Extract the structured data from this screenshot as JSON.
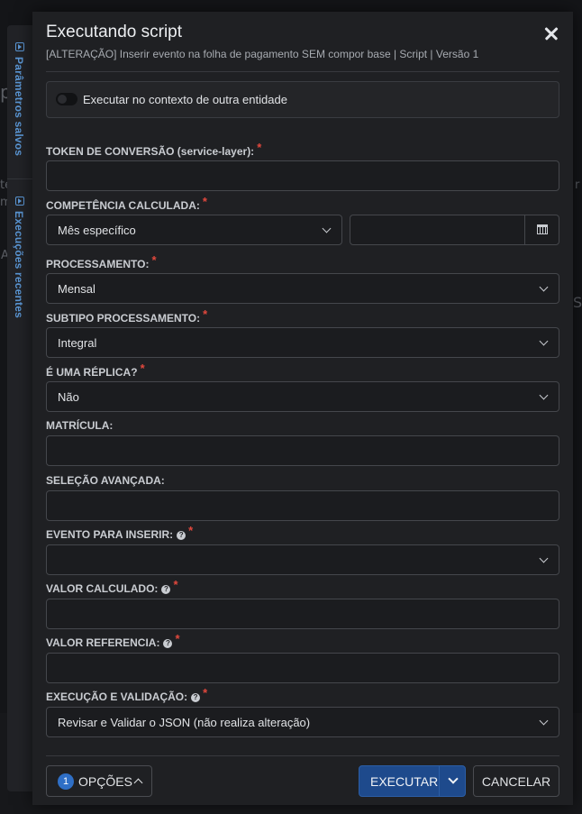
{
  "background": {
    "fragments": [
      "p",
      "te",
      "m",
      "A",
      "r",
      "S"
    ]
  },
  "side_panel": {
    "tab_saved": "Parâmetros salvos",
    "tab_recent": "Execuções recentes"
  },
  "modal": {
    "title": "Executando script",
    "subtitle": "[ALTERAÇÃO] Inserir evento na folha de pagamento SEM compor base | Script | Versão 1",
    "context_toggle": {
      "label": "Executar no contexto de outra entidade",
      "enabled": false
    },
    "required_mark": "*",
    "help_mark": "?",
    "fields": {
      "token": {
        "label": "TOKEN DE CONVERSÃO (service-layer):",
        "value": ""
      },
      "competencia": {
        "label": "COMPETÊNCIA CALCULADA:",
        "value": "Mês específico",
        "date_value": ""
      },
      "processamento": {
        "label": "PROCESSAMENTO:",
        "value": "Mensal"
      },
      "subtipo": {
        "label": "SUBTIPO PROCESSAMENTO:",
        "value": "Integral"
      },
      "replica": {
        "label": "É UMA RÉPLICA?",
        "value": "Não"
      },
      "matricula": {
        "label": "MATRÍCULA:",
        "value": ""
      },
      "selecao": {
        "label": "SELEÇÃO AVANÇADA:",
        "value": ""
      },
      "evento": {
        "label": "EVENTO PARA INSERIR:",
        "value": ""
      },
      "valor_calculado": {
        "label": "VALOR CALCULADO:",
        "value": ""
      },
      "valor_referencia": {
        "label": "VALOR REFERENCIA:",
        "value": ""
      },
      "execucao": {
        "label": "EXECUÇÃO E VALIDAÇÃO:",
        "value": "Revisar e Validar o JSON (não realiza alteração)"
      }
    },
    "footer": {
      "options_count": "1",
      "options_label": "OPÇÕES",
      "execute_label": "EXECUTAR",
      "cancel_label": "CANCELAR"
    }
  }
}
